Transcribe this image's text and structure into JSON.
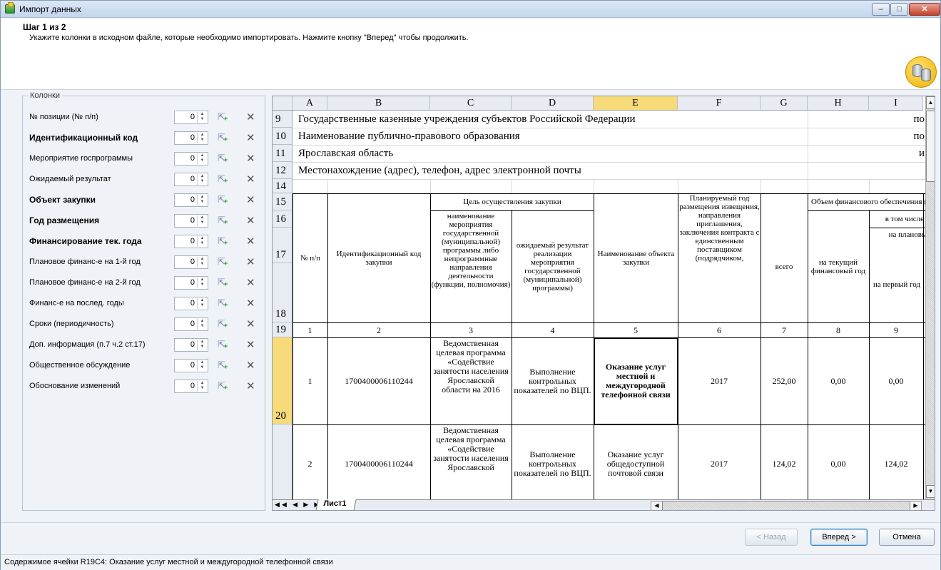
{
  "window": {
    "title": "Импорт данных",
    "min": "–",
    "max": "□",
    "close": "✕"
  },
  "header": {
    "step": "Шаг 1 из 2",
    "instruction": "Укажите колонки в исходном файле, которые необходимо импортировать. Нажмите кнопку \"Вперед\" чтобы продолжить."
  },
  "columns_panel": {
    "legend": "Колонки",
    "items": [
      {
        "label": "№ позиции (№ п/п)",
        "bold": false,
        "value": "0"
      },
      {
        "label": "Идентификационный код",
        "bold": true,
        "value": "0"
      },
      {
        "label": "Мероприятие госпрограммы",
        "bold": false,
        "value": "0"
      },
      {
        "label": "Ожидаемый результат",
        "bold": false,
        "value": "0"
      },
      {
        "label": "Объект закупки",
        "bold": true,
        "value": "0"
      },
      {
        "label": "Год размещения",
        "bold": true,
        "value": "0"
      },
      {
        "label": "Финансирование тек. года",
        "bold": true,
        "value": "0"
      },
      {
        "label": "Плановое финанс-е на 1-й год",
        "bold": false,
        "value": "0"
      },
      {
        "label": "Плановое финанс-е на 2-й год",
        "bold": false,
        "value": "0"
      },
      {
        "label": "Финанс-е на послед. годы",
        "bold": false,
        "value": "0"
      },
      {
        "label": "Сроки (периодичность)",
        "bold": false,
        "value": "0"
      },
      {
        "label": "Доп. информация  (п.7 ч.2 ст.17)",
        "bold": false,
        "value": "0"
      },
      {
        "label": "Общественное обсуждение",
        "bold": false,
        "value": "0"
      },
      {
        "label": "Обоснование изменений",
        "bold": false,
        "value": "0"
      }
    ]
  },
  "sheet": {
    "col_letters": [
      "A",
      "B",
      "C",
      "D",
      "E",
      "F",
      "G",
      "H",
      "I"
    ],
    "row_numbers": [
      "9",
      "10",
      "11",
      "12",
      "14",
      "15",
      "16",
      "17",
      "18",
      "19",
      "20",
      ""
    ],
    "text_rows": {
      "r9": "Государственные казенные учреждения субъектов Российской Федерации",
      "r9_right": "по",
      "r10": "Наименование публично-правового образования",
      "r10_right": "по",
      "r11": "Ярославская область",
      "r11_right": "и",
      "r12": "Местонахождение (адрес), телефон, адрес электронной почты"
    },
    "headers": {
      "num": "№ п/п",
      "ident": "Идентификационный код закупки",
      "purpose": "Цель осуществления закупки",
      "purpose_c": "наименование мероприятия государственной (муниципальной) программы либо непрограммные направления деятельности (функции, полномочия)",
      "purpose_d": "ожидаемый результат реализации мероприятия государственной (муниципальной) программы)",
      "object": "Наименование объекта закупки",
      "year": "Планируемый год размещения извещения, направления приглашения, заключения контракта с единственным поставщиком (подрядчиком,",
      "volume": "Объем финансового обеспечения (ты",
      "total": "всего",
      "incl": "в том числе",
      "current": "на текущий финансовый год",
      "planned": "на плановь",
      "first": "на первый год"
    },
    "col_numbers": [
      "1",
      "2",
      "3",
      "4",
      "5",
      "6",
      "7",
      "8",
      "9"
    ],
    "data_rows": [
      {
        "num": "1",
        "code": "1700400006110244",
        "program": "Ведомственная целевая программа «Содействие занятости населения Ярославской области на 2016",
        "result": "Выполнение контрольных показателей по ВЦП.",
        "object": "Оказание услуг местной и междугородной телефонной связи",
        "year": "2017",
        "total": "252,00",
        "current": "0,00",
        "first": "0,00"
      },
      {
        "num": "2",
        "code": "1700400006110244",
        "program": "Ведомственная целевая программа «Содействие занятости населения Ярославской",
        "result": "Выполнение контрольных показателей по ВЦП.",
        "object": "Оказание услуг общедоступной почтовой связи",
        "year": "2017",
        "total": "124,02",
        "current": "0,00",
        "first": "124,02"
      }
    ],
    "sheet_tab": "Лист1"
  },
  "buttons": {
    "back": "< Назад",
    "next": "Вперед >",
    "cancel": "Отмена"
  },
  "status": "Содержимое ячейки R19C4: Оказание услуг местной и междугородной телефонной связи",
  "colors": {
    "selected_header": "#f7db7a",
    "titlebar": "#c4d6ee",
    "close": "#c7402c"
  }
}
